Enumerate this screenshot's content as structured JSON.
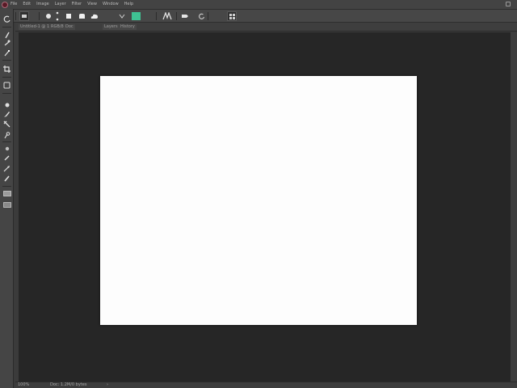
{
  "app": {
    "logo": "app-logo",
    "menu": [
      "File",
      "Edit",
      "Image",
      "Layer",
      "Filter",
      "View",
      "Window",
      "Help"
    ]
  },
  "options_bar": {
    "tools": [
      "tool-preset-icon",
      "ellipse-icon",
      "move-handle-icon",
      "rectangle-icon",
      "rounded-shape-icon",
      "cloud-shape-icon",
      "text-mode-icon",
      "path-icon",
      "fill-bucket-icon",
      "refresh-icon",
      "align-icon"
    ],
    "fill_color": "#3fc293"
  },
  "tabs": [
    "Untitled-1 @ 100%",
    "RGB/8",
    "Doc",
    "Layers",
    "History"
  ],
  "toolbar": {
    "tools": [
      "move-icon",
      "marquee-icon",
      "lasso-icon",
      "magic-wand-icon",
      "crop-icon",
      "eyedropper-icon",
      "healing-brush-icon",
      "brush-icon",
      "clone-stamp-icon",
      "eraser-icon",
      "gradient-icon",
      "blur-icon",
      "dodge-icon",
      "pen-icon",
      "type-icon",
      "path-select-icon",
      "shape-icon",
      "hand-icon"
    ]
  },
  "canvas": {
    "background": "#fdfdfd"
  },
  "status": {
    "zoom": "100%",
    "info": "Doc: 1.2M/0 bytes",
    "arrow": "›"
  }
}
